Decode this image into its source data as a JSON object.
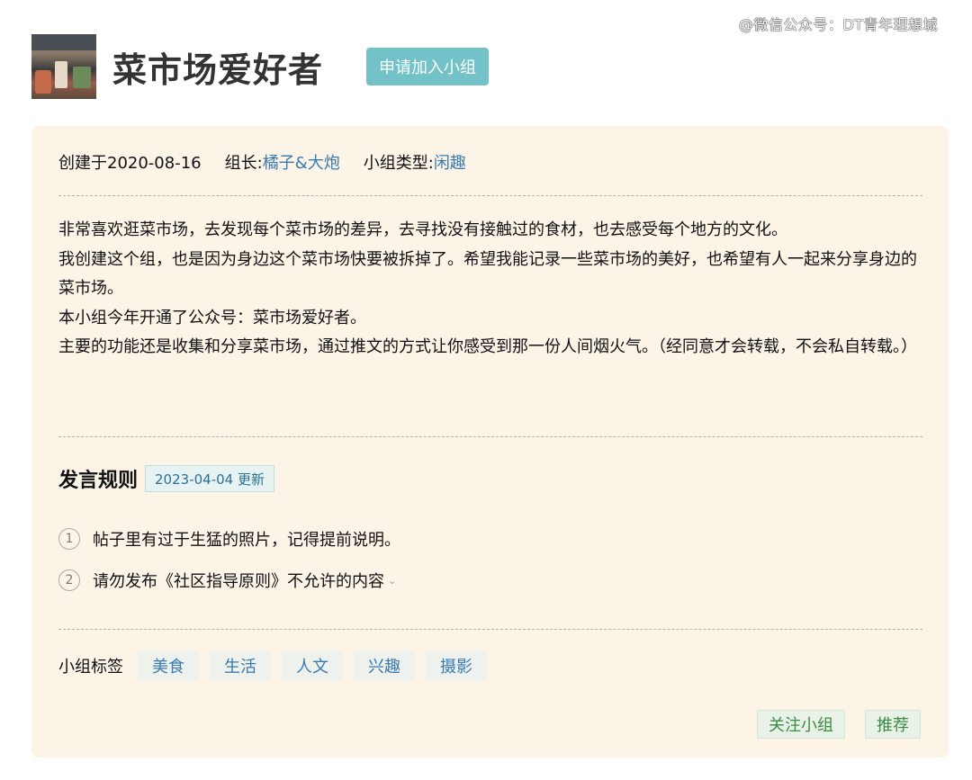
{
  "watermark": "@微信公众号：DT青年理想城",
  "group": {
    "name": "菜市场爱好者",
    "join_label": "申请加入小组"
  },
  "meta": {
    "created": "创建于2020-08-16",
    "leader_label": "组长:",
    "leader_name": "橘子&大炮",
    "type_label": "小组类型:",
    "type_value": "闲趣"
  },
  "description": [
    "非常喜欢逛菜市场，去发现每个菜市场的差异，去寻找没有接触过的食材，也去感受每个地方的文化。",
    "我创建这个组，也是因为身边这个菜市场快要被拆掉了。希望我能记录一些菜市场的美好，也希望有人一起来分享身边的菜市场。",
    "本小组今年开通了公众号：菜市场爱好者。",
    "主要的功能还是收集和分享菜市场，通过推文的方式让你感受到那一份人间烟火气。（经同意才会转载，不会私自转载。）"
  ],
  "rules": {
    "title": "发言规则",
    "updated": "2023-04-04 更新",
    "items": [
      {
        "num": "1",
        "text": "帖子里有过于生猛的照片，记得提前说明。"
      },
      {
        "num": "2",
        "text": "请勿发布《社区指导原则》不允许的内容"
      }
    ]
  },
  "tags": {
    "label": "小组标签",
    "items": [
      "美食",
      "生活",
      "人文",
      "兴趣",
      "摄影"
    ]
  },
  "actions": {
    "follow": "关注小组",
    "recommend": "推荐"
  },
  "colors": {
    "card_bg": "#fdf4e8",
    "join_button": "#73c2c7",
    "link": "#3a7ab0",
    "action_green": "#3d8a46"
  }
}
